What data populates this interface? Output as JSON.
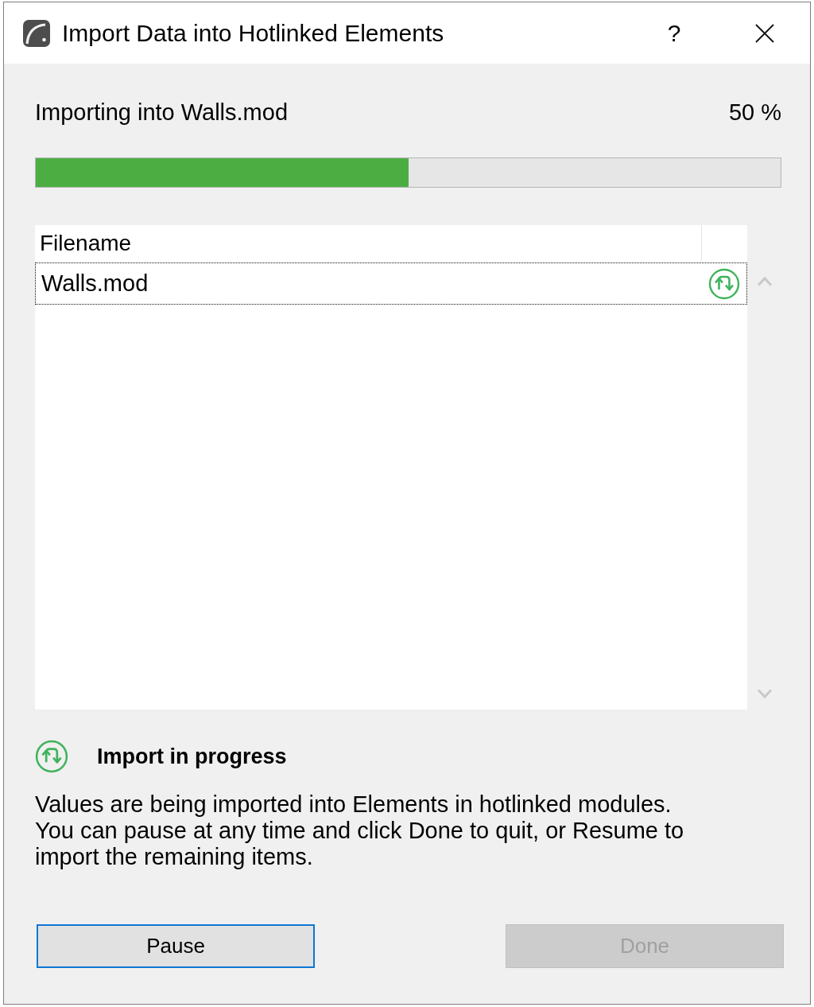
{
  "window": {
    "title": "Import Data into Hotlinked Elements",
    "help": "?"
  },
  "progress": {
    "label": "Importing into Walls.mod",
    "percent": "50 %",
    "level": 0.5
  },
  "table": {
    "columns": [
      "Filename"
    ],
    "rows": [
      {
        "filename": "Walls.mod",
        "selected": true
      }
    ]
  },
  "status": {
    "title": "Import in progress",
    "message": [
      "Values are being imported into Elements in hotlinked modules.",
      "You can pause at any time and click Done to quit, or Resume to import the remaining items."
    ]
  },
  "buttons": [
    {
      "label": "Pause",
      "default": true,
      "disabled": false
    },
    {
      "label": "Done",
      "default": false,
      "disabled": true
    }
  ]
}
